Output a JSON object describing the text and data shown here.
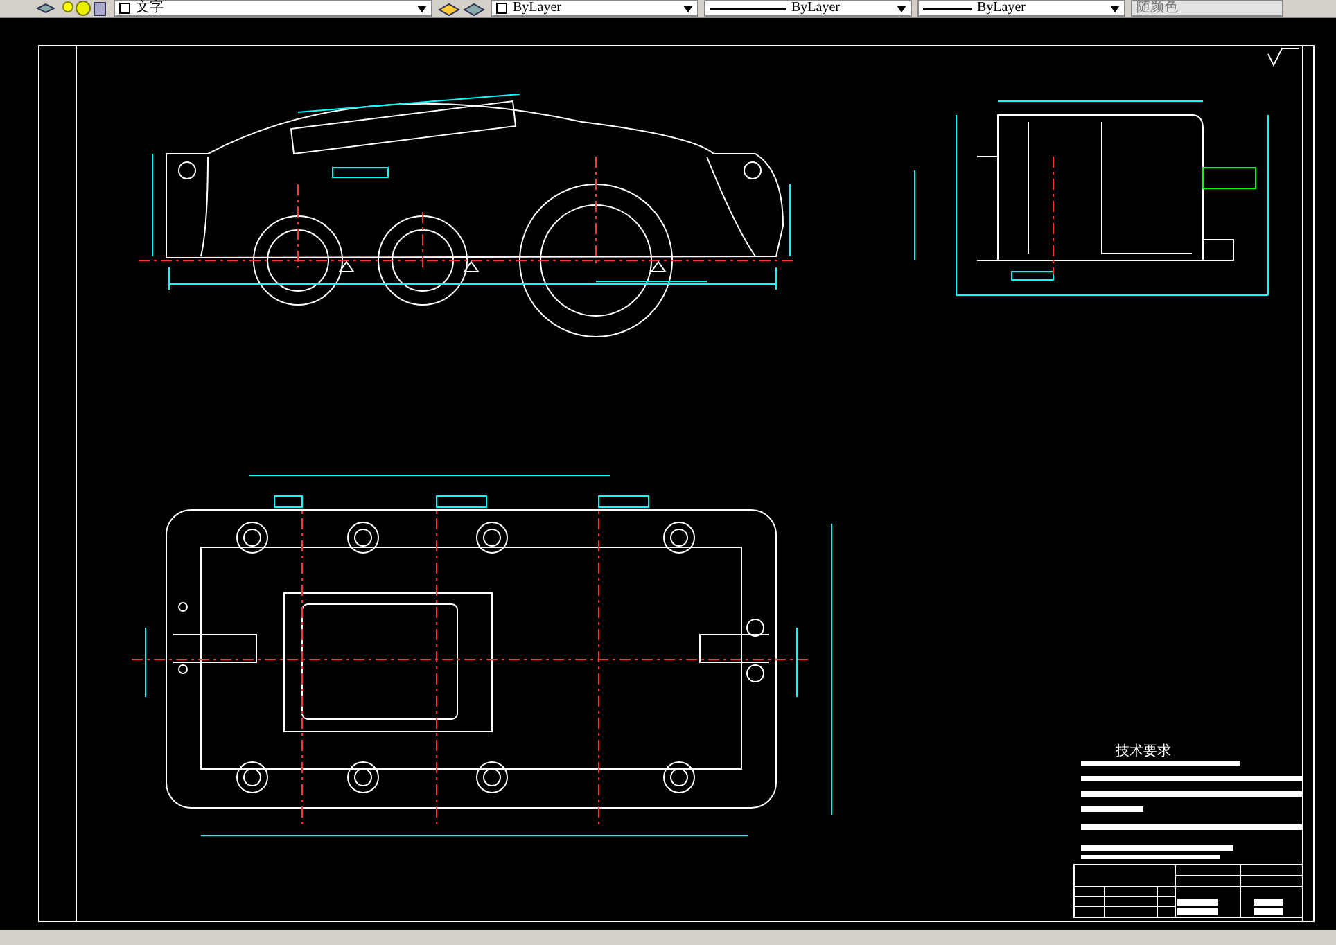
{
  "toolbar": {
    "text_style": "文字",
    "layer": "ByLayer",
    "linetype": "ByLayer",
    "lineweight": "ByLayer",
    "color_setting": "随颜色"
  },
  "drawing": {
    "notes_title": "技术要求"
  }
}
